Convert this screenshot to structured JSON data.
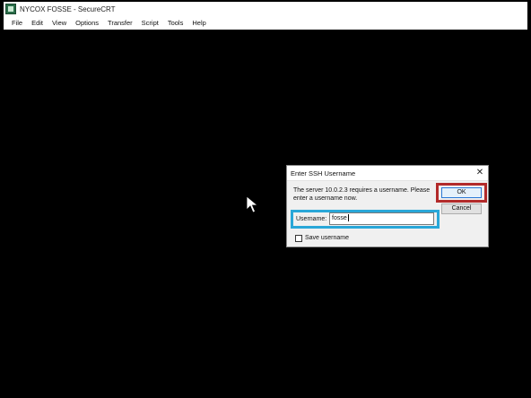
{
  "window": {
    "title": "NYCOX FOSSE - SecureCRT"
  },
  "menubar": {
    "items": [
      "File",
      "Edit",
      "View",
      "Options",
      "Transfer",
      "Script",
      "Tools",
      "Help"
    ]
  },
  "dialog": {
    "title": "Enter SSH Username",
    "close_glyph": "✕",
    "message": "The server 10.0.2.3 requires a username.  Please enter a username now.",
    "ok_label": "OK",
    "cancel_label": "Cancel",
    "username_label": "Username:",
    "username_value": "fosse",
    "save_username_label": "Save username",
    "save_username_checked": false
  },
  "colors": {
    "ok_highlight": "#b22a2a",
    "username_highlight": "#29a7d8",
    "terminal_background": "#000000"
  }
}
